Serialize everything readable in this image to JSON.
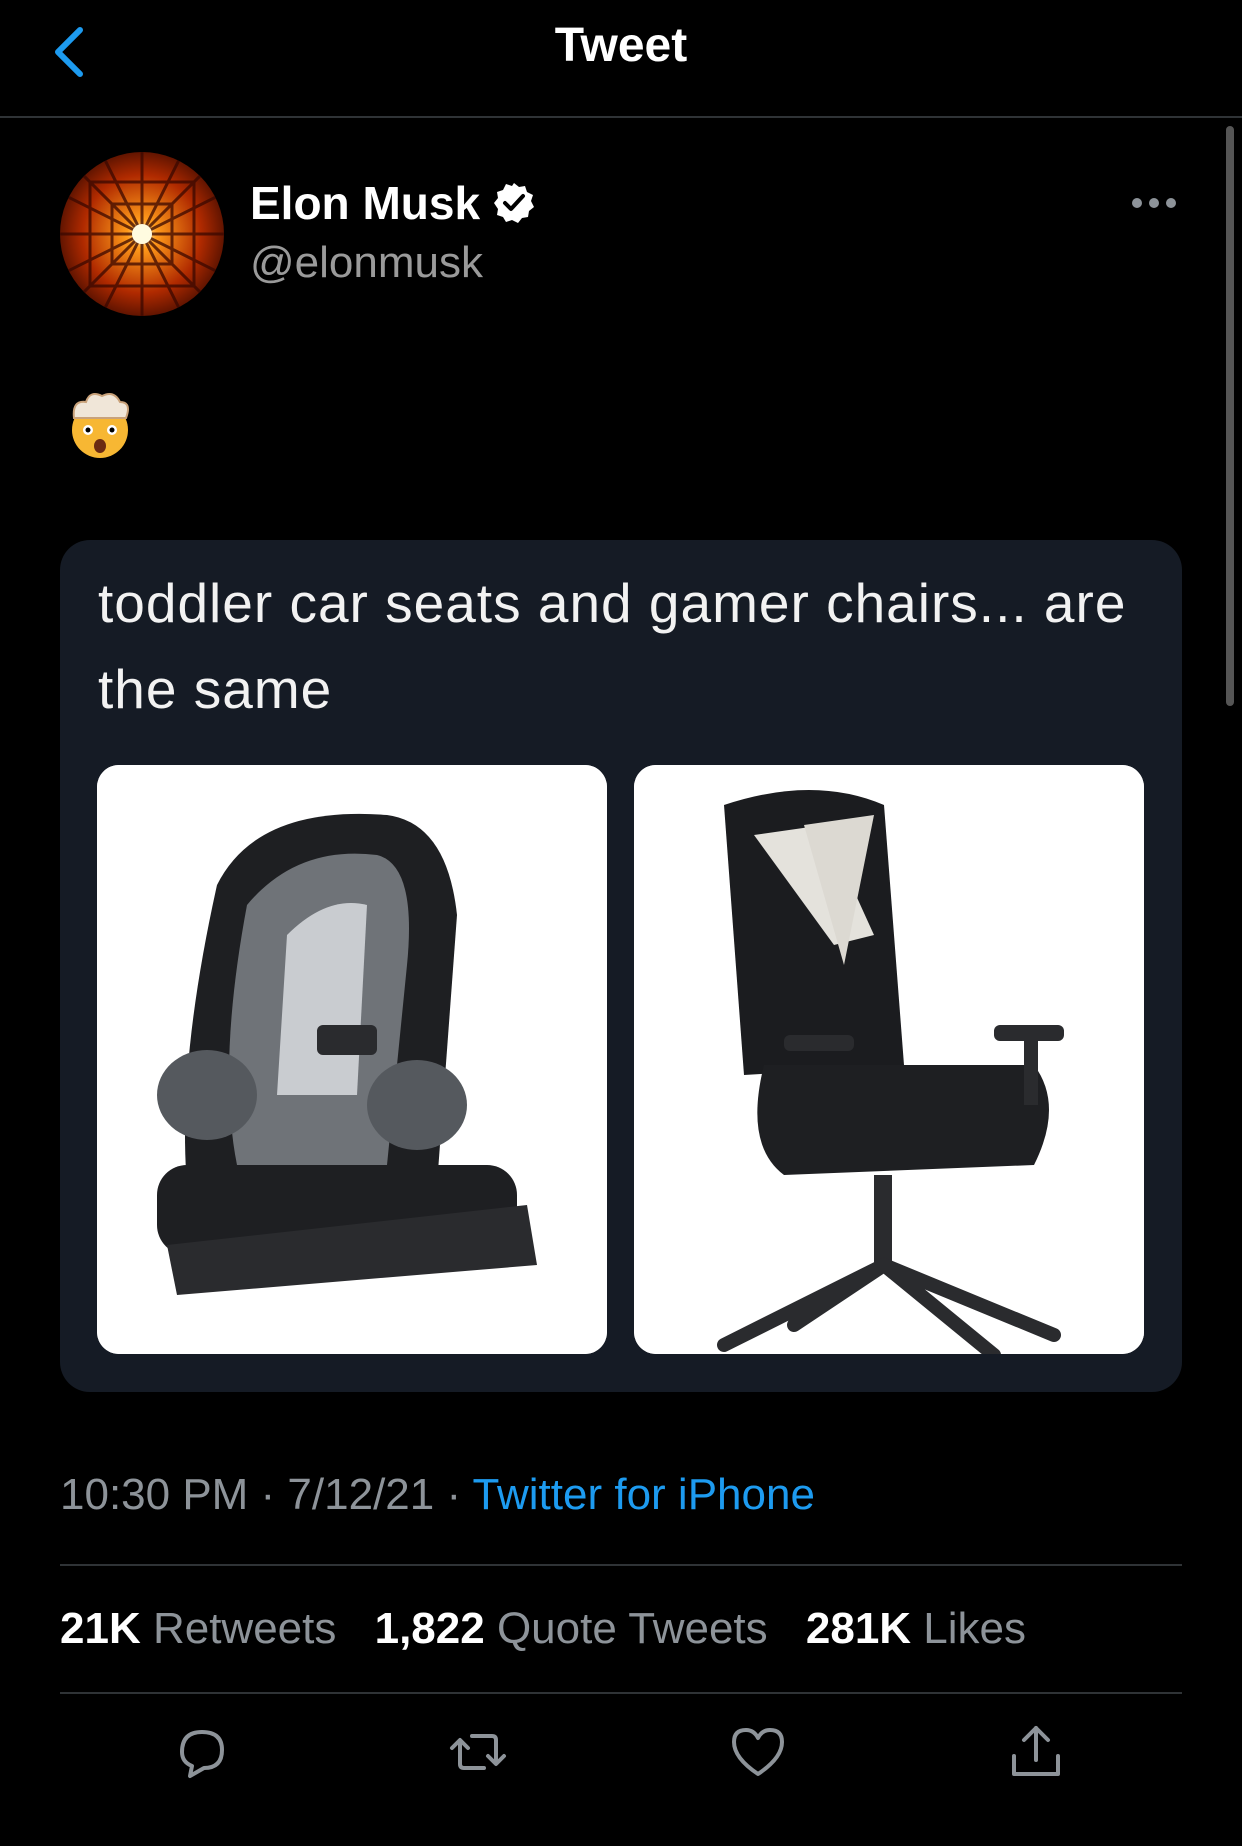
{
  "header": {
    "title": "Tweet"
  },
  "tweet": {
    "author": {
      "name": "Elon Musk",
      "handle": "@elonmusk"
    },
    "card_text": "toddler car seats and gamer chairs... are the same",
    "timestamp": "10:30 PM · 7/12/21 · ",
    "source": "Twitter for iPhone",
    "stats": {
      "retweets_count": "21K",
      "retweets_label": "Retweets",
      "quotes_count": "1,822",
      "quotes_label": "Quote Tweets",
      "likes_count": "281K",
      "likes_label": "Likes"
    }
  },
  "icons": [
    "back-chevron-icon",
    "verified-badge-icon",
    "more-icon",
    "reply-icon",
    "retweet-icon",
    "like-icon",
    "share-icon"
  ],
  "colors": {
    "accent": "#1d9bf0",
    "secondary_text": "#8d9399",
    "card_bg": "#151b25"
  }
}
